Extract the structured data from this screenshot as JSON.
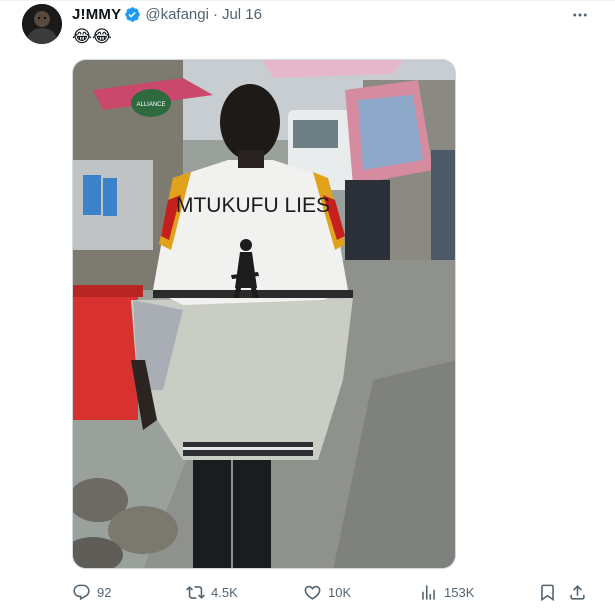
{
  "tweet": {
    "display_name": "J!MMY",
    "handle": "@kafangi",
    "separator": "·",
    "date": "Jul 16",
    "text": "😂😂"
  },
  "media": {
    "shirt_text": "MTUKUFU LIES",
    "sign_text": "ALLIANCE"
  },
  "actions": {
    "replies": "92",
    "reposts": "4.5K",
    "likes": "10K",
    "views": "153K"
  },
  "colors": {
    "verified": "#1d9bf0",
    "muted_text": "#536471",
    "border": "#cfd9de"
  },
  "icons": [
    "verified-badge-icon",
    "more-options-icon",
    "reply-icon",
    "retweet-icon",
    "like-icon",
    "views-icon",
    "bookmark-icon",
    "share-icon"
  ]
}
